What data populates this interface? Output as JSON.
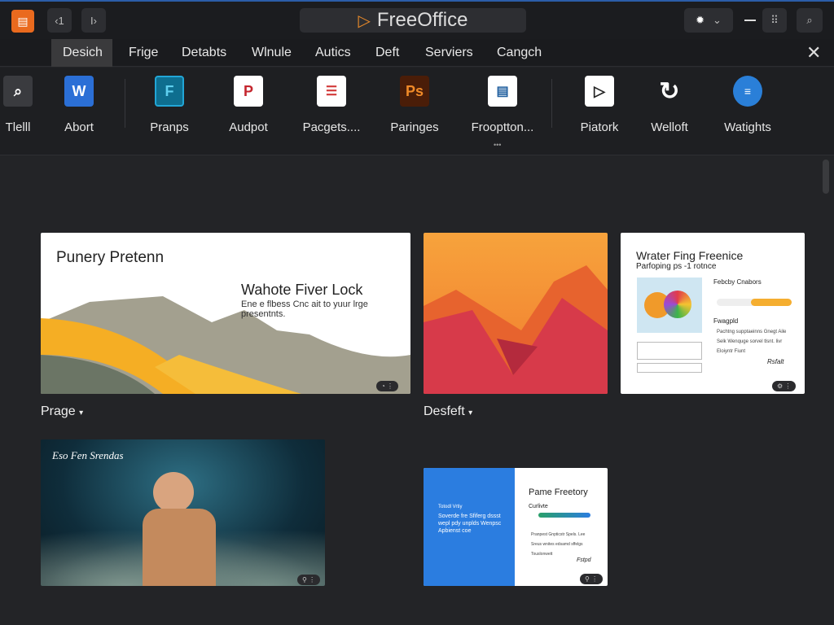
{
  "titlebar": {
    "app_title": "FreeOffice",
    "back_label": "‹1",
    "forward_label": "I›"
  },
  "menu": {
    "tabs": [
      "Desich",
      "Frige",
      "Detabts",
      "Wlnule",
      "Autics",
      "Deft",
      "Serviers",
      "Cangch"
    ],
    "active": 0
  },
  "ribbon": {
    "items": [
      {
        "label": "Tlelll",
        "icon": "search-icon"
      },
      {
        "label": "Abort",
        "icon": "word-icon"
      },
      {
        "label": "Pranps",
        "icon": "file-f-icon"
      },
      {
        "label": "Audpot",
        "icon": "presentation-p-icon"
      },
      {
        "label": "Pacgets....",
        "icon": "document-red-icon"
      },
      {
        "label": "Paringes",
        "icon": "photoshop-icon"
      },
      {
        "label": "Frooptton...",
        "icon": "spreadsheet-icon"
      },
      {
        "label": "Piatork",
        "icon": "play-folder-icon"
      },
      {
        "label": "Welloft",
        "icon": "refresh-icon"
      },
      {
        "label": "Watights",
        "icon": "chat-icon"
      }
    ],
    "more": "•••"
  },
  "templates": {
    "card1": {
      "title": "Punery Pretenn",
      "heading": "Wahote Fiver Lock",
      "body": "Ene e flbess Cnc ait to yuur lrge presentnts.",
      "label": "Prage"
    },
    "card2": {
      "label": "Desfeft"
    },
    "card3": {
      "title": "Wrater Fing Freenice",
      "subtitle": "Parfoping ps -1 rotnce",
      "side_heading": "Febcby Cnabors",
      "list_heading": "Fwagpld",
      "items": [
        "Pachtng supptaeinns Gnegt Aile",
        "Selk Wenquge sorvel tlsnt. livr",
        "Eloiyntr Fiunt"
      ],
      "signature": "Rsfalt"
    },
    "card4": {
      "title": "Eso Fen Srendas"
    },
    "card5": {
      "left_kicker": "Totodl Vrtiy",
      "left_heading": "Soverde fre Sfiferg dssst wepl pdy unplds Wenpsc Apbienst coe",
      "right_title": "Pame Freetory",
      "right_sub": "Curlivte",
      "items": [
        "Pranpest Gnpticstr Spels. Lee",
        "Sreus wnites edsamd sffelgs",
        "Touslonwett"
      ],
      "signature": "Fstpd"
    }
  },
  "colors": {
    "accent": "#ea6a1e",
    "blue": "#2b7de0",
    "yellow": "#f5b12a"
  }
}
